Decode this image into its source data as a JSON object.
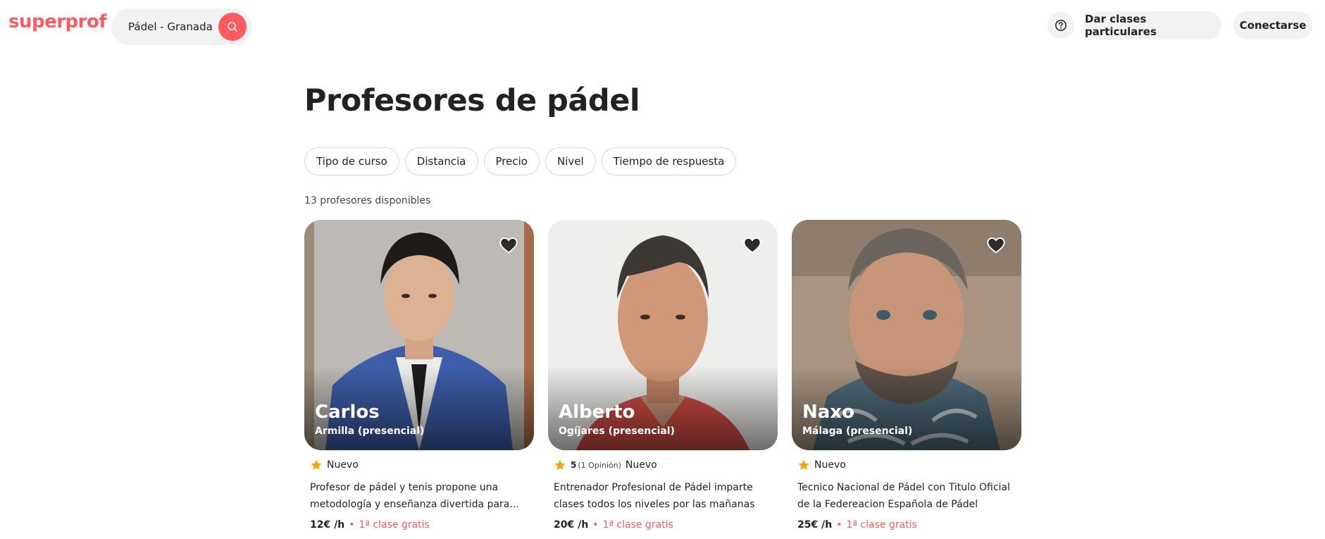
{
  "header": {
    "logo": "superprof",
    "search_text": "Pádel - Granada",
    "give_classes": "Dar clases particulares",
    "login": "Conectarse"
  },
  "page_title": "Profesores de pádel",
  "filters": [
    "Tipo de curso",
    "Distancia",
    "Precio",
    "Nivel",
    "Tiempo de respuesta"
  ],
  "results_count": "13 profesores disponibles",
  "colors": {
    "brand": "#ff5a5f",
    "star": "#f7a400"
  },
  "teachers": [
    {
      "name": "Carlos",
      "city": "Armilla (presencial)",
      "score": "",
      "reviews": "",
      "badge": "Nuevo",
      "desc": "Profesor de pádel y tenis propone una metodología y enseñanza divertida para...",
      "price": "12€ /h",
      "free_class": "1ª clase gratis"
    },
    {
      "name": "Alberto",
      "city": "Ogíjares (presencial)",
      "score": "5",
      "reviews": "(1 Opinión)",
      "badge": "Nuevo",
      "desc": "Entrenador Profesional de Pádel imparte clases todos los niveles por las mañanas",
      "price": "20€ /h",
      "free_class": "1ª clase gratis"
    },
    {
      "name": "Naxo",
      "city": "Málaga (presencial)",
      "score": "",
      "reviews": "",
      "badge": "Nuevo",
      "desc": "Tecnico Nacional de Pádel con Titulo Oficial de la Federeacion Española de Pádel",
      "price": "25€ /h",
      "free_class": "1ª clase gratis"
    }
  ]
}
